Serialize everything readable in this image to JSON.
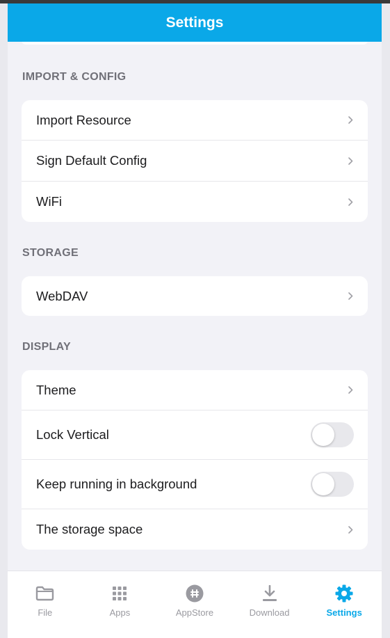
{
  "header": {
    "title": "Settings"
  },
  "sections": [
    {
      "label": "IMPORT & CONFIG",
      "items": [
        {
          "label": "Import Resource",
          "control": "chevron"
        },
        {
          "label": "Sign Default Config",
          "control": "chevron"
        },
        {
          "label": "WiFi",
          "control": "chevron"
        }
      ]
    },
    {
      "label": "STORAGE",
      "items": [
        {
          "label": "WebDAV",
          "control": "chevron"
        }
      ]
    },
    {
      "label": "DISPLAY",
      "items": [
        {
          "label": "Theme",
          "control": "chevron"
        },
        {
          "label": "Lock Vertical",
          "control": "toggle",
          "on": false
        },
        {
          "label": "Keep running in background",
          "control": "toggle",
          "on": false
        },
        {
          "label": "The storage space",
          "control": "chevron"
        }
      ]
    }
  ],
  "tabbar": {
    "active": "settings",
    "tabs": [
      {
        "id": "file",
        "label": "File",
        "icon": "folder-icon"
      },
      {
        "id": "apps",
        "label": "Apps",
        "icon": "grid-icon"
      },
      {
        "id": "appstore",
        "label": "AppStore",
        "icon": "appstore-icon"
      },
      {
        "id": "download",
        "label": "Download",
        "icon": "download-icon"
      },
      {
        "id": "settings",
        "label": "Settings",
        "icon": "gear-icon"
      }
    ]
  },
  "colors": {
    "accent": "#0aa8e8",
    "inactive": "#9a9aa0"
  }
}
